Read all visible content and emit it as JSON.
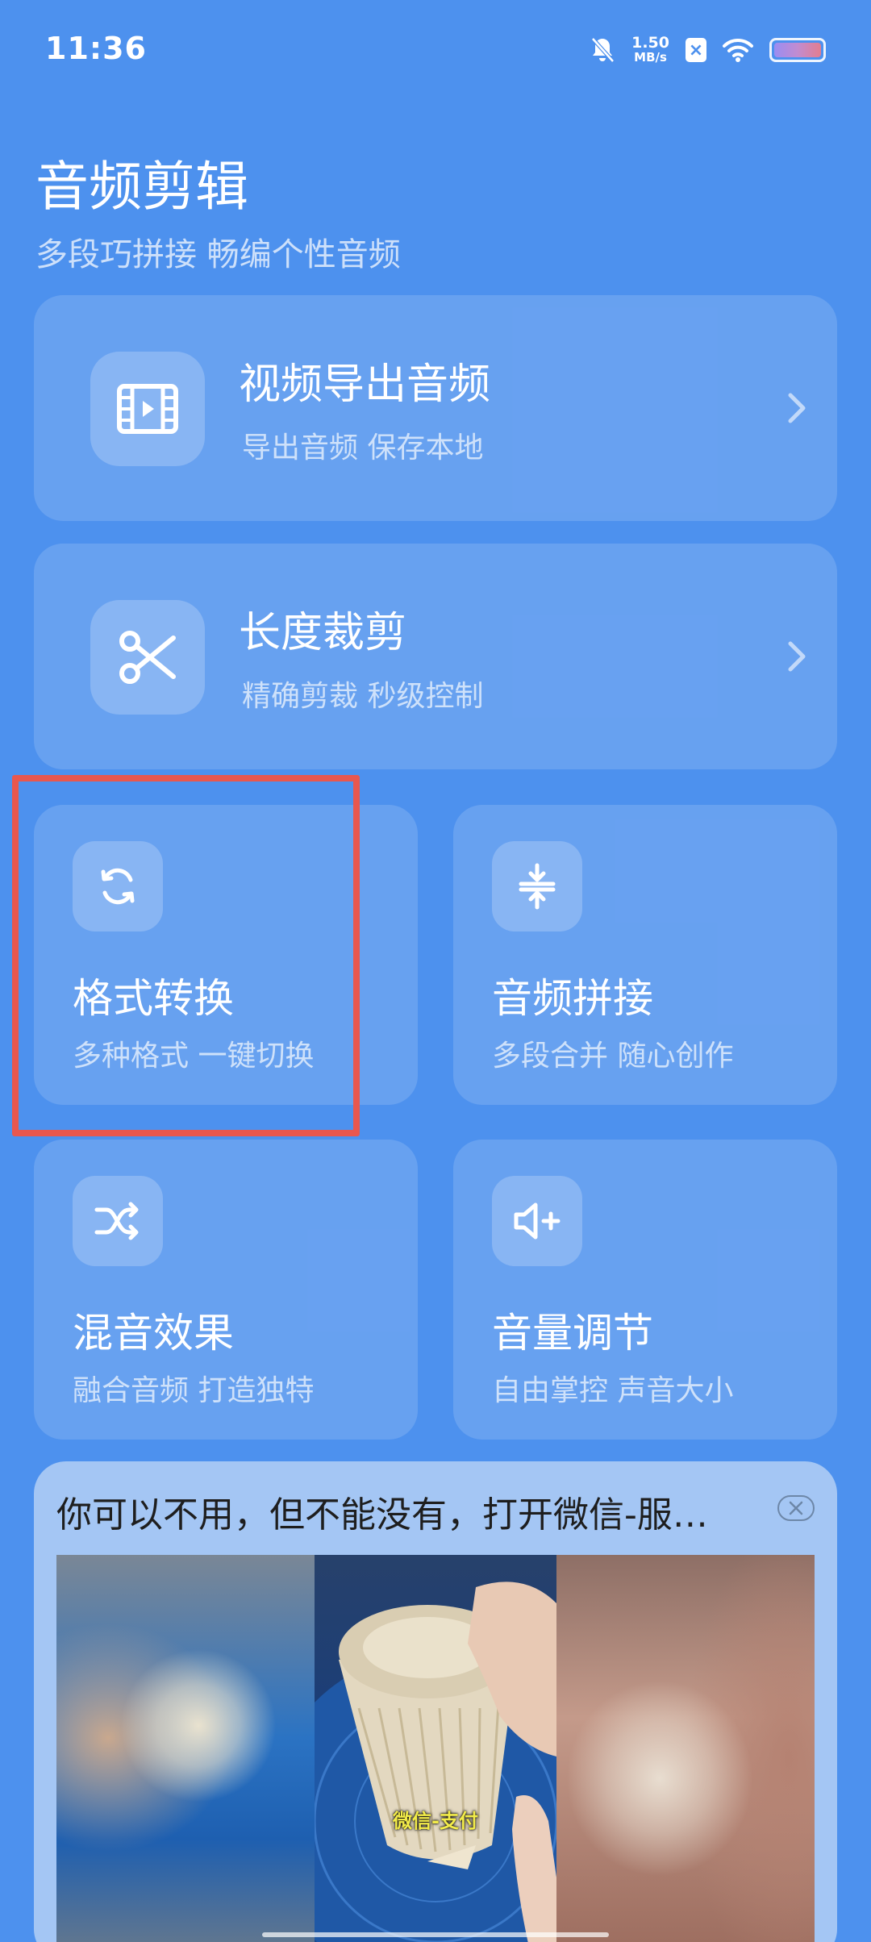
{
  "status_bar": {
    "time": "11:36",
    "net_speed_value": "1.50",
    "net_speed_unit": "MB/s",
    "sim_label": "×",
    "icons": [
      "bell-off-icon",
      "sim-x-icon",
      "wifi-icon",
      "battery-icon"
    ]
  },
  "header": {
    "title": "音频剪辑",
    "subtitle": "多段巧拼接 畅编个性音频"
  },
  "wide_cards": [
    {
      "title": "视频导出音频",
      "subtitle": "导出音频 保存本地",
      "icon": "film-icon"
    },
    {
      "title": "长度裁剪",
      "subtitle": "精确剪裁 秒级控制",
      "icon": "scissors-icon"
    }
  ],
  "grid_cards": [
    {
      "title": "格式转换",
      "subtitle": "多种格式 一键切换",
      "icon": "refresh-icon"
    },
    {
      "title": "音频拼接",
      "subtitle": "多段合并 随心创作",
      "icon": "merge-icon"
    },
    {
      "title": "混音效果",
      "subtitle": "融合音频 打造独特",
      "icon": "shuffle-icon"
    },
    {
      "title": "音量调节",
      "subtitle": "自由掌控 声音大小",
      "icon": "volume-plus-icon"
    }
  ],
  "ad": {
    "title": "你可以不用，但不能没有，打开微信-服…",
    "caption": "微信-支付",
    "close_icon": "close-icon"
  },
  "colors": {
    "background": "#4d91ee",
    "highlight": "#e8574e",
    "ad_background": "#a4c6f4"
  }
}
